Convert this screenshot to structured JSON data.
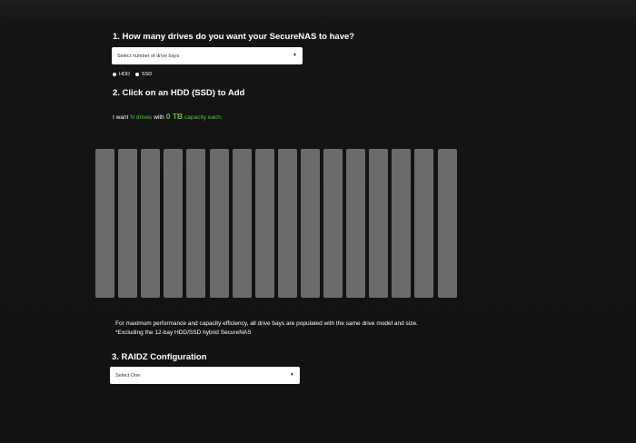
{
  "step1": {
    "heading": "1. How many drives do you want your SecureNAS to have?",
    "select_placeholder": "Select number of drive bays",
    "drive_types": [
      {
        "label": "HDD"
      },
      {
        "label": "SSD"
      }
    ]
  },
  "step2": {
    "heading": "2. Click on an HDD (SSD) to Add",
    "summary": {
      "prefix": "I want",
      "drive_count": "N drives",
      "with_text": "with",
      "capacity": "0 TB",
      "suffix": "capacity each."
    },
    "bay_count": 16,
    "bay_color": "#6b6b6b",
    "accent_color": "#5fbf3f",
    "note_line1": "For maximum performance and capacity efficiency, all drive bays are populated with the same drive model and size.",
    "note_line2": "*Excluding the 12-bay HDD/SSD hybrid SecureNAS"
  },
  "step3": {
    "heading": "3. RAIDZ Configuration",
    "select_placeholder": "Select One"
  },
  "icons": {
    "dropdown": "chevron-down-icon",
    "radio": "radio-dot-icon"
  }
}
